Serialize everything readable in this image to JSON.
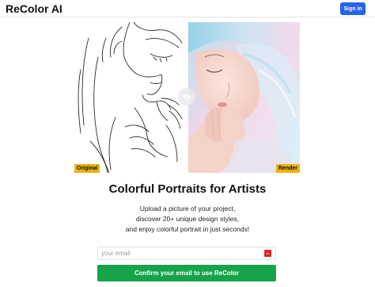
{
  "header": {
    "brand": "ReColor AI",
    "signin_label": "Sign in"
  },
  "compare": {
    "left_tag": "Original",
    "right_tag": "Render"
  },
  "hero": {
    "title": "Colorful Portraits for Artists",
    "line1": "Upload a picture of your project,",
    "line2": "discover 20+ unique design styles,",
    "line3": "and enjoy colorful portrait in just seconds!"
  },
  "form": {
    "email_placeholder": "your email",
    "cta_label": "Confirm your email to use ReColor"
  },
  "colors": {
    "primary_blue": "#2563eb",
    "tag_yellow": "#eab308",
    "cta_green": "#16a34a"
  },
  "icons": [
    "line-art-portrait",
    "color-portrait",
    "slider-handle-icon",
    "password-manager-icon"
  ]
}
